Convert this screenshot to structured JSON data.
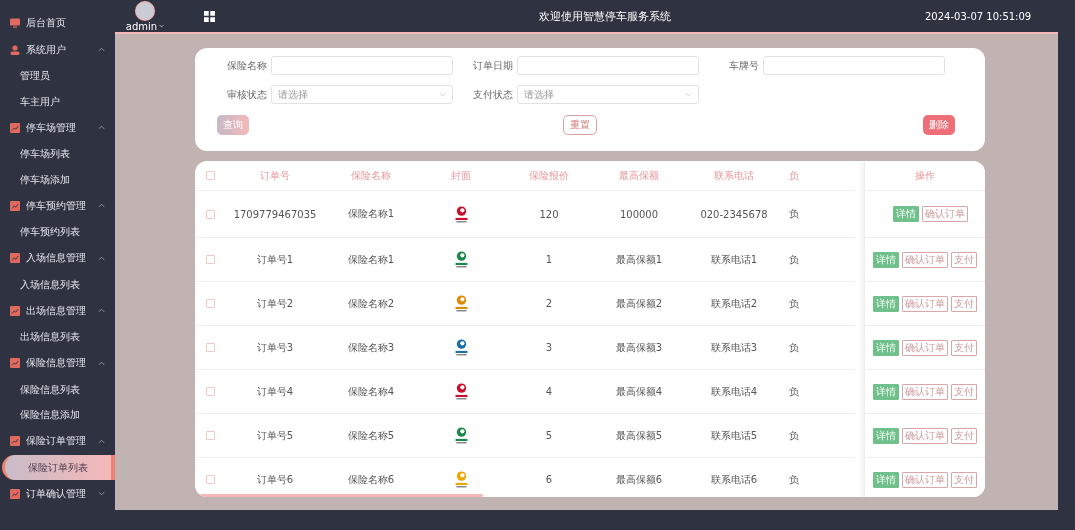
{
  "header": {
    "user": "admin",
    "title": "欢迎使用智慧停车服务系统",
    "datetime": "2024-03-07 10:51:09"
  },
  "sidebar": {
    "items": [
      {
        "label": "后台首页",
        "kind": "screen"
      },
      {
        "label": "系统用户",
        "kind": "user",
        "expanded": true,
        "children": [
          {
            "label": "管理员",
            "selected": false
          },
          {
            "label": "车主用户",
            "selected": false
          }
        ]
      },
      {
        "label": "停车场管理",
        "kind": "chart",
        "expanded": true,
        "children": [
          {
            "label": "停车场列表",
            "selected": false
          },
          {
            "label": "停车场添加",
            "selected": false
          }
        ]
      },
      {
        "label": "停车预约管理",
        "kind": "chart",
        "expanded": true,
        "children": [
          {
            "label": "停车预约列表",
            "selected": false
          }
        ]
      },
      {
        "label": "入场信息管理",
        "kind": "chart",
        "expanded": true,
        "children": [
          {
            "label": "入场信息列表",
            "selected": false
          }
        ]
      },
      {
        "label": "出场信息管理",
        "kind": "chart",
        "expanded": true,
        "children": [
          {
            "label": "出场信息列表",
            "selected": false
          }
        ]
      },
      {
        "label": "保险信息管理",
        "kind": "chart",
        "expanded": true,
        "children": [
          {
            "label": "保险信息列表",
            "selected": false
          },
          {
            "label": "保险信息添加",
            "selected": false
          }
        ]
      },
      {
        "label": "保险订单管理",
        "kind": "chart",
        "expanded": true,
        "children": [
          {
            "label": "保险订单列表",
            "selected": true
          }
        ]
      },
      {
        "label": "订单确认管理",
        "kind": "chart",
        "expanded": false
      }
    ]
  },
  "search": {
    "fields": [
      {
        "label": "保险名称",
        "kind": "text"
      },
      {
        "label": "订单日期",
        "kind": "text"
      },
      {
        "label": "车牌号",
        "kind": "text"
      },
      {
        "label": "审核状态",
        "kind": "select",
        "placeholder": "请选择"
      },
      {
        "label": "支付状态",
        "kind": "select",
        "placeholder": "请选择"
      }
    ],
    "buttons": [
      "查询",
      "重置",
      "删除"
    ]
  },
  "table": {
    "columns": [
      "订单号",
      "保险名称",
      "封面",
      "保险报价",
      "最高保额",
      "联系电话",
      "负",
      "操作"
    ],
    "header_checked": false,
    "rows": [
      {
        "checked": false,
        "cells": [
          "1709779467035",
          "保险名称1",
          "",
          "120",
          "100000",
          "020-2345678",
          "负"
        ],
        "actions": [
          "详情",
          "确认订单"
        ]
      },
      {
        "checked": false,
        "cells": [
          "订单号1",
          "保险名称1",
          "",
          "1",
          "最高保额1",
          "联系电话1",
          "负"
        ],
        "actions": [
          "详情",
          "确认订单",
          "支付"
        ]
      },
      {
        "checked": false,
        "cells": [
          "订单号2",
          "保险名称2",
          "",
          "2",
          "最高保额2",
          "联系电话2",
          "负"
        ],
        "actions": [
          "详情",
          "确认订单",
          "支付"
        ]
      },
      {
        "checked": false,
        "cells": [
          "订单号3",
          "保险名称3",
          "",
          "3",
          "最高保额3",
          "联系电话3",
          "负"
        ],
        "actions": [
          "详情",
          "确认订单",
          "支付"
        ]
      },
      {
        "checked": false,
        "cells": [
          "订单号4",
          "保险名称4",
          "",
          "4",
          "最高保额4",
          "联系电话4",
          "负"
        ],
        "actions": [
          "详情",
          "确认订单",
          "支付"
        ]
      },
      {
        "checked": false,
        "cells": [
          "订单号5",
          "保险名称5",
          "",
          "5",
          "最高保额5",
          "联系电话5",
          "负"
        ],
        "actions": [
          "详情",
          "确认订单",
          "支付"
        ]
      },
      {
        "checked": false,
        "cells": [
          "订单号6",
          "保险名称6",
          "",
          "6",
          "最高保额6",
          "联系电话6",
          "负"
        ],
        "actions": [
          "详情",
          "确认订单",
          "支付"
        ]
      }
    ]
  }
}
